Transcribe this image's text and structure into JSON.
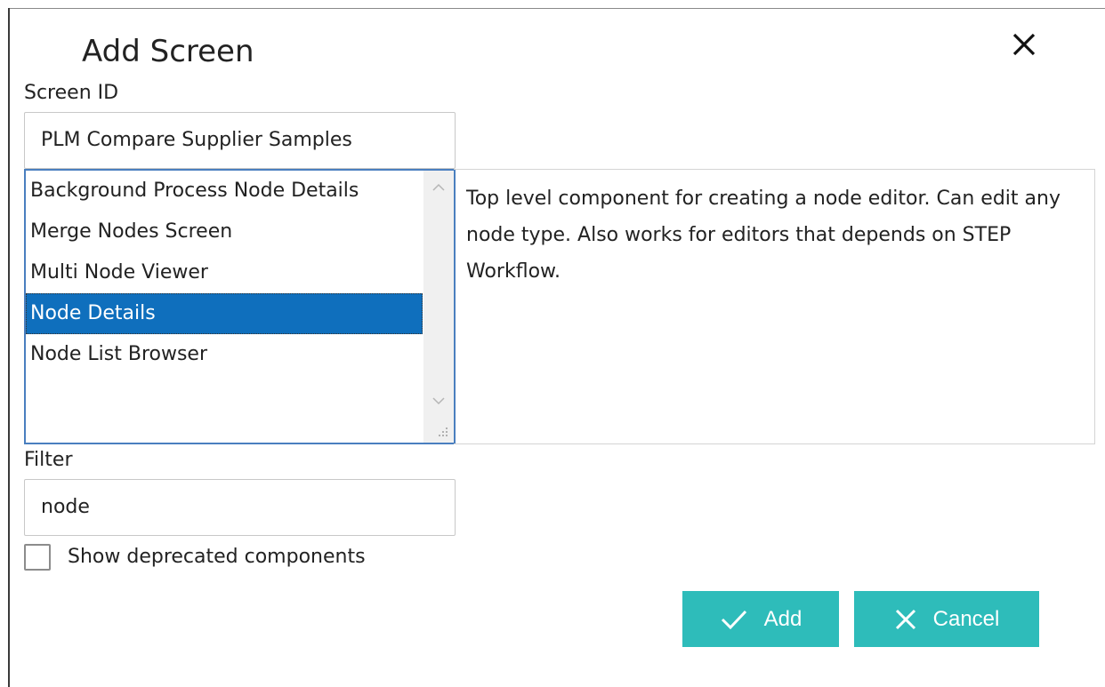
{
  "dialog": {
    "title": "Add Screen"
  },
  "screen_id": {
    "label": "Screen ID",
    "value": "PLM Compare Supplier Samples"
  },
  "component_list": {
    "items": [
      {
        "label": "Background Process Node Details",
        "selected": false
      },
      {
        "label": "Merge Nodes Screen",
        "selected": false
      },
      {
        "label": "Multi Node Viewer",
        "selected": false
      },
      {
        "label": "Node Details",
        "selected": true
      },
      {
        "label": "Node List Browser",
        "selected": false
      }
    ]
  },
  "description": {
    "text": "Top level component for creating a node editor. Can edit any node type. Also works for editors that depends on STEP Workflow."
  },
  "filter": {
    "label": "Filter",
    "value": "node"
  },
  "deprecated": {
    "label": "Show deprecated components",
    "checked": false
  },
  "buttons": {
    "add_label": "Add",
    "cancel_label": "Cancel"
  },
  "colors": {
    "accent": "#2ebcba",
    "selection": "#0f6fbd",
    "list_border": "#4a7fbf"
  },
  "icons": {
    "close": "close-icon",
    "add": "checkmark-icon",
    "cancel": "x-icon",
    "scroll_up": "chevron-up-icon",
    "scroll_down": "chevron-down-icon",
    "resize": "resize-grip-icon"
  }
}
